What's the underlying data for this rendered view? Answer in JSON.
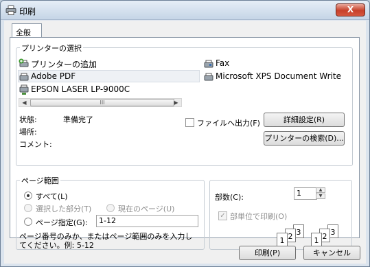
{
  "window": {
    "title": "印刷",
    "close_label": "X"
  },
  "tabs": [
    {
      "label": "全般"
    }
  ],
  "printer_select": {
    "label": "プリンターの選択",
    "printers": [
      {
        "label": "プリンターの追加",
        "icon": "add-printer-icon"
      },
      {
        "label": "Fax",
        "icon": "fax-printer-icon"
      },
      {
        "label": "Adobe PDF",
        "icon": "printer-icon",
        "selected": true
      },
      {
        "label": "Microsoft XPS Document Write",
        "icon": "printer-icon"
      },
      {
        "label": "EPSON LASER LP-9000C",
        "icon": "network-printer-icon"
      }
    ],
    "scroll_thumb_grip": "III",
    "status_label": "状態:",
    "status_value": "準備完了",
    "location_label": "場所:",
    "comment_label": "コメント:",
    "print_to_file_label": "ファイルへ出力(F)",
    "details_button": "詳細設定(R)",
    "find_printer_button": "プリンターの検索(D)..."
  },
  "page_range": {
    "label": "ページ範囲",
    "all": "すべて(L)",
    "selection": "選択した部分(T)",
    "current_page": "現在のページ(U)",
    "pages": "ページ指定(G):",
    "pages_value": "1-12",
    "hint_line1": "ページ番号のみか、またはページ範囲のみを入力し",
    "hint_line2": "てください。例: 5-12"
  },
  "copies": {
    "label": "部数(C):",
    "value": "1",
    "collate_label": "部単位で印刷(O)",
    "collate_pages": [
      "1",
      "2",
      "3",
      "1",
      "2",
      "3"
    ]
  },
  "footer": {
    "print_button": "印刷(P)",
    "cancel_button": "キャンセル"
  }
}
